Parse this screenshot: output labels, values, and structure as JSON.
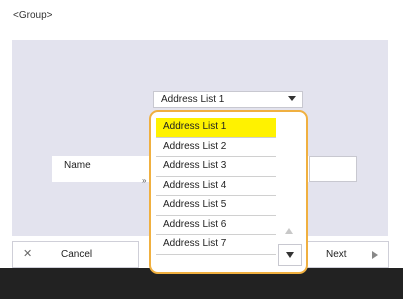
{
  "heading": "<Group>",
  "dropdown": {
    "selected": "Address List 1"
  },
  "name_label": "Name",
  "name_marker": "»",
  "list": {
    "items": [
      "Address List 1",
      "Address List 2",
      "Address List 3",
      "Address List 4",
      "Address List 5",
      "Address List 6",
      "Address List 7"
    ]
  },
  "buttons": {
    "cancel": "Cancel",
    "next": "Next"
  },
  "icons": {
    "cancel": "close-icon",
    "next": "play-arrow-icon",
    "dropdown": "chevron-down-icon"
  },
  "colors": {
    "highlight": "#fff200",
    "list_border": "#f0b040"
  }
}
